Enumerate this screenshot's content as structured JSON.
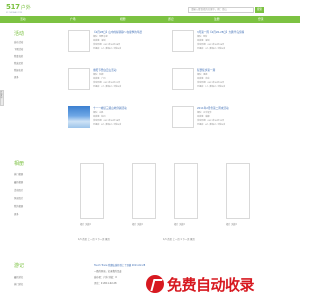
{
  "header": {
    "logo_num": "517",
    "logo_cn": "户外",
    "logo_sub": "517HUWAI.COM",
    "search_placeholder": "请输入要查找的关键字，例：登山",
    "search_button": "搜索"
  },
  "nav": {
    "items": [
      "活动",
      "广场",
      "相册",
      "游记",
      "注册",
      "登录"
    ]
  },
  "side_tag": "在线客服",
  "activities": {
    "title": "活动",
    "side_links": [
      "发布活动",
      "下期活动",
      "我参加的",
      "我发起的",
      "我报名的",
      "更多"
    ],
    "cards": [
      {
        "title": "【2月28日】山中的绿荫静～在夏季的早晨",
        "lines": [
          "领队：绿野之家",
          "出发地：深圳",
          "活动日期：2011年02月28日",
          "已报名：5人 参加0人 浏览0次"
        ],
        "photo": false
      },
      {
        "title": "3月第一周【2月26-28日】大鹏半岛穿越",
        "lines": [
          "领队：阿甘",
          "出发地：深圳",
          "活动日期：2011年02月26日",
          "已报名：3人 参加0人 浏览0次"
        ],
        "photo": false
      },
      {
        "title": "重阳节登白云山活动",
        "lines": [
          "领队：红棉",
          "出发地：广州",
          "活动日期：2011年02月21日",
          "已报名：2人 参加0人 浏览0次"
        ],
        "photo": false
      },
      {
        "title": "狂野徒步第一期",
        "lines": [
          "领队：黑熊",
          "出发地：北京",
          "活动日期：2011年02月20日",
          "已报名：1人 参加0人 浏览0次"
        ],
        "photo": false
      },
      {
        "title": "十一一峰徒三级山地穿越活动",
        "lines": [
          "领队：山风",
          "出发地：杭州",
          "活动日期：2011年02月18日",
          "已报名：8人 参加0人 浏览0次"
        ],
        "photo": true
      },
      {
        "title": "2011年2月份第二周末活动",
        "lines": [
          "领队：云中漫步",
          "出发地：成都",
          "活动日期：2011年02月12日",
          "已报名：4人 参加0人 浏览0次"
        ],
        "photo": false
      }
    ]
  },
  "albums": {
    "title": "相册",
    "side_links": [
      "热门相册",
      "最新相册",
      "活动照片",
      "风景照片",
      "我的相册",
      "更多"
    ],
    "items": [
      {
        "caption": "相片 浏览0"
      },
      {
        "caption": "相片 浏览0"
      },
      {
        "caption": "相片 浏览0"
      },
      {
        "caption": "相片 浏览0"
      }
    ],
    "pager1": "1/1 首页 上一页 1 下一页 尾页",
    "pager2": "1/1 首页 上一页 1 下一页 尾页"
  },
  "diaries": {
    "title": "游记",
    "side_links": [
      "最新游记",
      "热门游记"
    ],
    "lines": [
      "Touch Trace 我翻山越岭登上了顶峰 2011-02-28",
      "一路的风景，记录我的足迹",
      "发布者：户外 浏览：0",
      "评论：0 2011-02-28"
    ],
    "right_line": "【一一年游记】"
  },
  "watermark": {
    "text": "免费自动收录"
  },
  "colors": {
    "brand_green": "#7cc242",
    "link_blue": "#3b6bb3",
    "watermark_red": "#d71920"
  }
}
